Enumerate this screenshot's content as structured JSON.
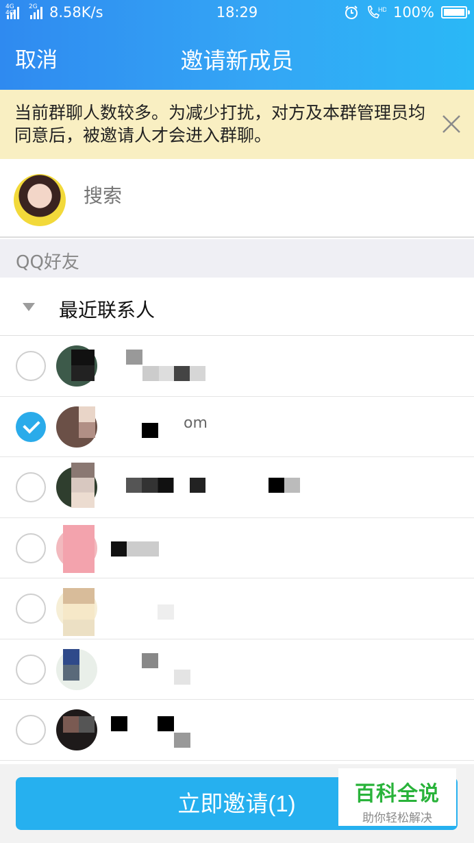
{
  "status_bar": {
    "signal1_label": "4G 4G",
    "signal2_label": "2G",
    "speed": "8.58K/s",
    "time": "18:29",
    "battery": "100%",
    "icons": [
      "alarm-icon",
      "hd-call-icon",
      "battery-icon"
    ]
  },
  "header": {
    "cancel_label": "取消",
    "title": "邀请新成员"
  },
  "notice": {
    "text": "当前群聊人数较多。为减少打扰，对方及本群管理员均同意后，被邀请人才会进入群聊。",
    "close_icon": "close-icon"
  },
  "search": {
    "placeholder": "搜索"
  },
  "section": {
    "label": "QQ好友"
  },
  "group": {
    "label": "最近联系人",
    "expanded": true
  },
  "contacts": [
    {
      "checked": false,
      "visible_name": ""
    },
    {
      "checked": true,
      "visible_name": "om"
    },
    {
      "checked": false,
      "visible_name": ""
    },
    {
      "checked": false,
      "visible_name": ""
    },
    {
      "checked": false,
      "visible_name": ""
    },
    {
      "checked": false,
      "visible_name": ""
    },
    {
      "checked": false,
      "visible_name": ""
    }
  ],
  "footer": {
    "invite_label": "立即邀请(1)"
  },
  "watermark": {
    "main": "百科全说",
    "sub": "助你轻松解决"
  },
  "colors": {
    "header_start": "#2f8af0",
    "header_end": "#2ab8f6",
    "notice_bg": "#f9efc2",
    "accent": "#26b0ef",
    "watermark_green": "#29b33a"
  }
}
